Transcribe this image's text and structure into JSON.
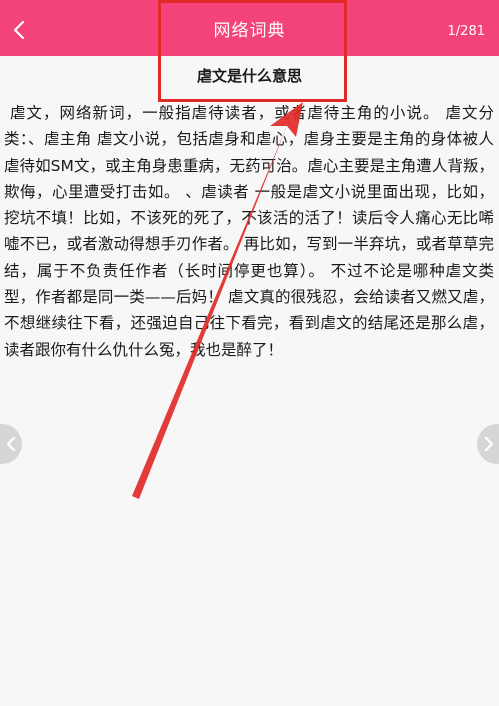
{
  "header": {
    "title": "网络词典",
    "page_counter": "1/281",
    "background_color": "#f4437a",
    "back_icon": "chevron-left-icon"
  },
  "entry": {
    "word_title": "虐文是什么意思",
    "content": " 虐文，网络新词，一般指虐待读者，或者虐待主角的小说。 虐文分类：、虐主角 虐文小说，包括虐身和虐心，虐身主要是主角的身体被人虐待如SM文，或主角身患重病，无药可治。虐心主要是主角遭人背叛，欺侮，心里遭受打击如。 、虐读者 一般是虐文小说里面出现，比如，挖坑不填！比如，不该死的死了，不该活的活了！读后令人痛心无比唏嘘不已，或者激动得想手刃作者。 再比如，写到一半弃坑，或者草草完结，属于不负责任作者（长时间停更也算）。 不过不论是哪种虐文类型，作者都是同一类——后妈！ 虐文真的很残忍，会给读者又燃又虐，不想继续往下看，还强迫自己往下看完，看到虐文的结尾还是那么虐，读者跟你有什么仇什么冤，我也是醉了！"
  },
  "navigation": {
    "prev_icon": "chevron-left-icon",
    "next_icon": "chevron-right-icon"
  },
  "annotation": {
    "color": "#e02a28"
  }
}
